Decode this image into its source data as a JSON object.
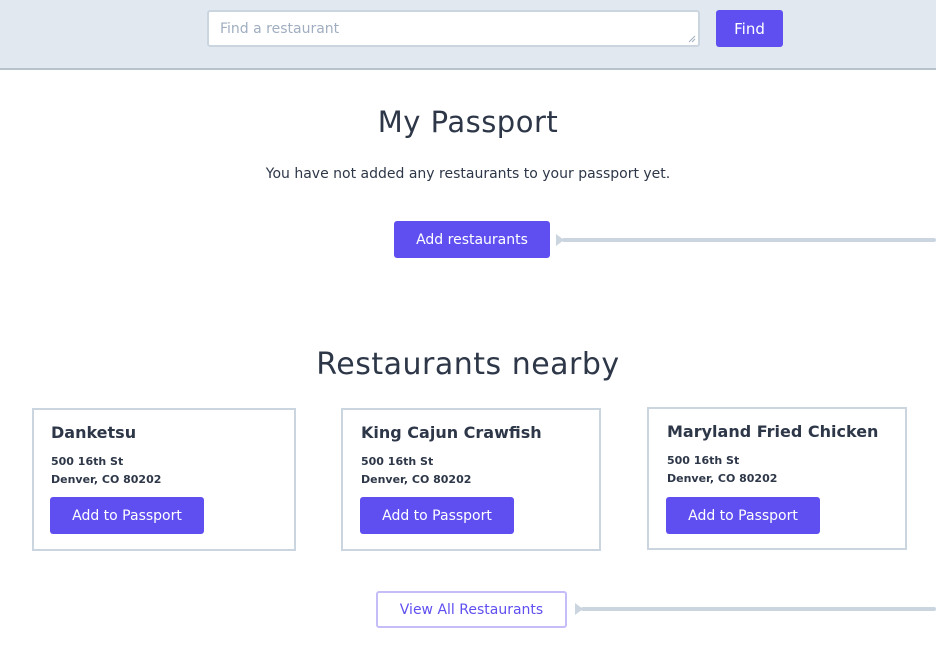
{
  "search": {
    "placeholder": "Find a restaurant",
    "button_label": "Find"
  },
  "passport": {
    "title": "My Passport",
    "empty_message": "You have not added any restaurants to your passport yet.",
    "add_button_label": "Add restaurants"
  },
  "nearby": {
    "title": "Restaurants nearby",
    "restaurants": [
      {
        "name": "Danketsu",
        "address_line1": "500 16th St",
        "address_line2": "Denver, CO 80202",
        "button_label": "Add to Passport"
      },
      {
        "name": "King Cajun Crawfish",
        "address_line1": "500 16th St",
        "address_line2": "Denver, CO 80202",
        "button_label": "Add to Passport"
      },
      {
        "name": "Maryland Fried Chicken",
        "address_line1": "500 16th St",
        "address_line2": "Denver, CO 80202",
        "button_label": "Add to Passport"
      }
    ],
    "view_all_label": "View All Restaurants"
  },
  "colors": {
    "accent": "#5f4ff0",
    "topbar_bg": "#e2e8f0",
    "border": "#cbd5e0",
    "text": "#2d3748"
  }
}
